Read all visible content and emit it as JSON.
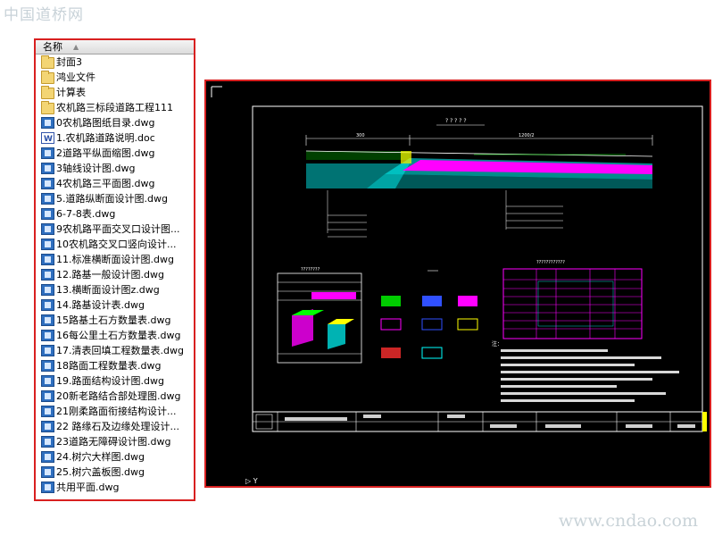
{
  "watermark_top": "中国道桥网",
  "watermark_bottom": "www.cndao.com",
  "file_list": {
    "column_header": "名称",
    "items": [
      {
        "name": "封面3",
        "type": "folder"
      },
      {
        "name": "鸿业文件",
        "type": "folder"
      },
      {
        "name": "计算表",
        "type": "folder"
      },
      {
        "name": "农机路三标段道路工程111",
        "type": "folder"
      },
      {
        "name": "0农机路图纸目录.dwg",
        "type": "dwg"
      },
      {
        "name": "1.农机路道路说明.doc",
        "type": "doc"
      },
      {
        "name": "2道路平纵面缩图.dwg",
        "type": "dwg"
      },
      {
        "name": "3轴线设计图.dwg",
        "type": "dwg"
      },
      {
        "name": "4农机路三平面图.dwg",
        "type": "dwg"
      },
      {
        "name": "5.道路纵断面设计图.dwg",
        "type": "dwg"
      },
      {
        "name": "6-7-8表.dwg",
        "type": "dwg"
      },
      {
        "name": "9农机路平面交叉口设计图...",
        "type": "dwg"
      },
      {
        "name": "10农机路交叉口竖向设计...",
        "type": "dwg"
      },
      {
        "name": "11.标准横断面设计图.dwg",
        "type": "dwg"
      },
      {
        "name": "12.路基一般设计图.dwg",
        "type": "dwg"
      },
      {
        "name": "13.横断面设计图z.dwg",
        "type": "dwg"
      },
      {
        "name": "14.路基设计表.dwg",
        "type": "dwg"
      },
      {
        "name": "15路基土石方数量表.dwg",
        "type": "dwg"
      },
      {
        "name": "16每公里土石方数量表.dwg",
        "type": "dwg"
      },
      {
        "name": "17.清表回填工程数量表.dwg",
        "type": "dwg"
      },
      {
        "name": "18路面工程数量表.dwg",
        "type": "dwg"
      },
      {
        "name": "19.路面结构设计图.dwg",
        "type": "dwg"
      },
      {
        "name": "20新老路结合部处理图.dwg",
        "type": "dwg"
      },
      {
        "name": "21刚柔路面衔接结构设计...",
        "type": "dwg"
      },
      {
        "name": "22 路缘石及边缘处理设计...",
        "type": "dwg"
      },
      {
        "name": "23道路无障碍设计图.dwg",
        "type": "dwg"
      },
      {
        "name": "24.树穴大样图.dwg",
        "type": "dwg"
      },
      {
        "name": "25.树穴盖板图.dwg",
        "type": "dwg"
      },
      {
        "name": "共用平面.dwg",
        "type": "dwg"
      }
    ]
  },
  "cad_preview": {
    "dimension_left": "300",
    "dimension_right": "1200/2",
    "section_title": "? ? ? ? ?",
    "table_header_label": "????????????",
    "notes_label": "注：",
    "colors": {
      "magenta": "#ff00ff",
      "cyan": "#00ffff",
      "green": "#00ff00",
      "blue": "#3050ff",
      "red": "#ff3030",
      "yellow": "#ffff00",
      "white": "#ffffff"
    }
  }
}
